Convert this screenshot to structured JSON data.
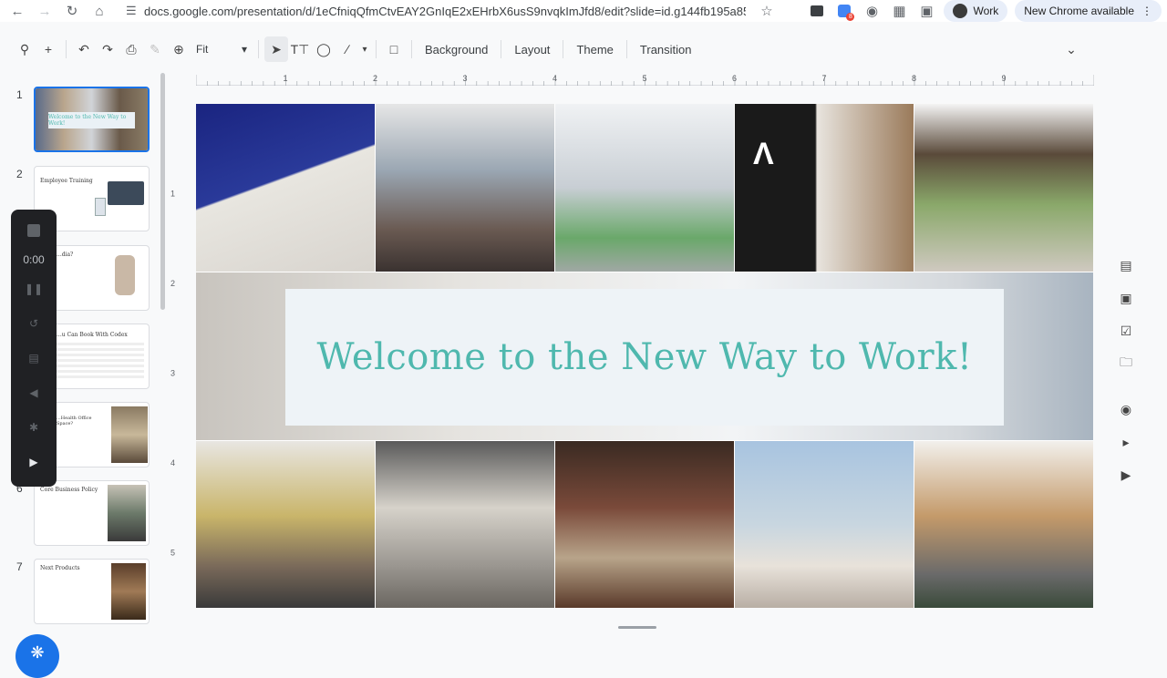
{
  "browser": {
    "url": "docs.google.com/presentation/d/1eCfniqQfmCtvEAY2GnIqE2xEHrbX6usS9nvqkImJfd8/edit?slide=id.g144fb195a85_...",
    "profile_label": "Work",
    "update_label": "New Chrome available",
    "extension_badge": "8"
  },
  "toolbar": {
    "zoom_label": "Fit",
    "background_label": "Background",
    "layout_label": "Layout",
    "theme_label": "Theme",
    "transition_label": "Transition"
  },
  "ruler": {
    "h_ticks": [
      "1",
      "2",
      "3",
      "4",
      "5",
      "6",
      "7",
      "8",
      "9"
    ],
    "v_ticks": [
      "1",
      "2",
      "3",
      "4",
      "5"
    ]
  },
  "slides": [
    {
      "num": "1",
      "title": "Welcome to the New Way to Work!"
    },
    {
      "num": "2",
      "title": "Employee Training"
    },
    {
      "num": "3",
      "title": "...dia?"
    },
    {
      "num": "4",
      "title": "...u Can Book With Codex"
    },
    {
      "num": "5",
      "title": "...Health Office Space?"
    },
    {
      "num": "6",
      "title": "Core Business Policy"
    },
    {
      "num": "7",
      "title": "Next Products"
    }
  ],
  "recorder": {
    "time": "0:00"
  },
  "slide_main": {
    "title": "Welcome to the New Way to Work!"
  },
  "colors": {
    "accent": "#1a73e8",
    "title_teal": "#4fb8ae"
  }
}
